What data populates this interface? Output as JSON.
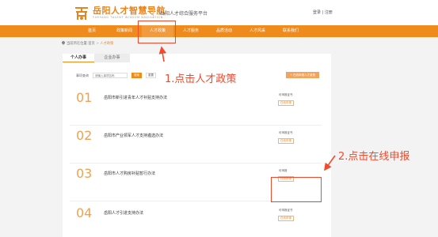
{
  "header": {
    "logo_title": "岳阳人才智慧导航",
    "logo_subtitle": "YUEYANG TALENT WISDOM NAVIGATION",
    "site_name": "岳阳人才综合服务平台",
    "login_text": "登录 | 注册"
  },
  "nav": {
    "items": [
      {
        "label": "首页"
      },
      {
        "label": "政策新闻"
      },
      {
        "label": "人才政策"
      },
      {
        "label": "人才服务"
      },
      {
        "label": "品质活动"
      },
      {
        "label": "人才风采"
      },
      {
        "label": "联系我们"
      }
    ],
    "active_index": 2
  },
  "breadcrumb": {
    "prefix": "当前所在位置:",
    "home": "首页",
    "sep": " > ",
    "current": "人才政策"
  },
  "tabs": {
    "personal": "个人办事",
    "company": "企业办事"
  },
  "filter": {
    "label": "事项查询",
    "placeholder": "请输入事项名称",
    "search_label": "搜索",
    "reset_label": "重置",
    "apply_all_label": "+ 在线申报人才政策"
  },
  "rows": [
    {
      "num": "01",
      "title": "岳阳市新引进青年人才补贴支持办法",
      "state": "可申报证书",
      "button": "在线申报"
    },
    {
      "num": "02",
      "title": "岳阳市产业领军人才支持遴选办法",
      "state": "可申报证书",
      "button": "在线申报"
    },
    {
      "num": "03",
      "title": "岳阳市人才购房补贴暂行办法",
      "state": "可申报",
      "button": "在线申报"
    },
    {
      "num": "04",
      "title": "岳阳人才引进支持办法",
      "state": "可申报证书",
      "button": "在线申报"
    }
  ],
  "annotations": {
    "step1": "1.点击人才政策",
    "step2": "2.点击在线申报",
    "color": "#f24a2d"
  },
  "colors": {
    "brand_orange": "#ef8a1d",
    "number_orange": "#f0a253"
  }
}
